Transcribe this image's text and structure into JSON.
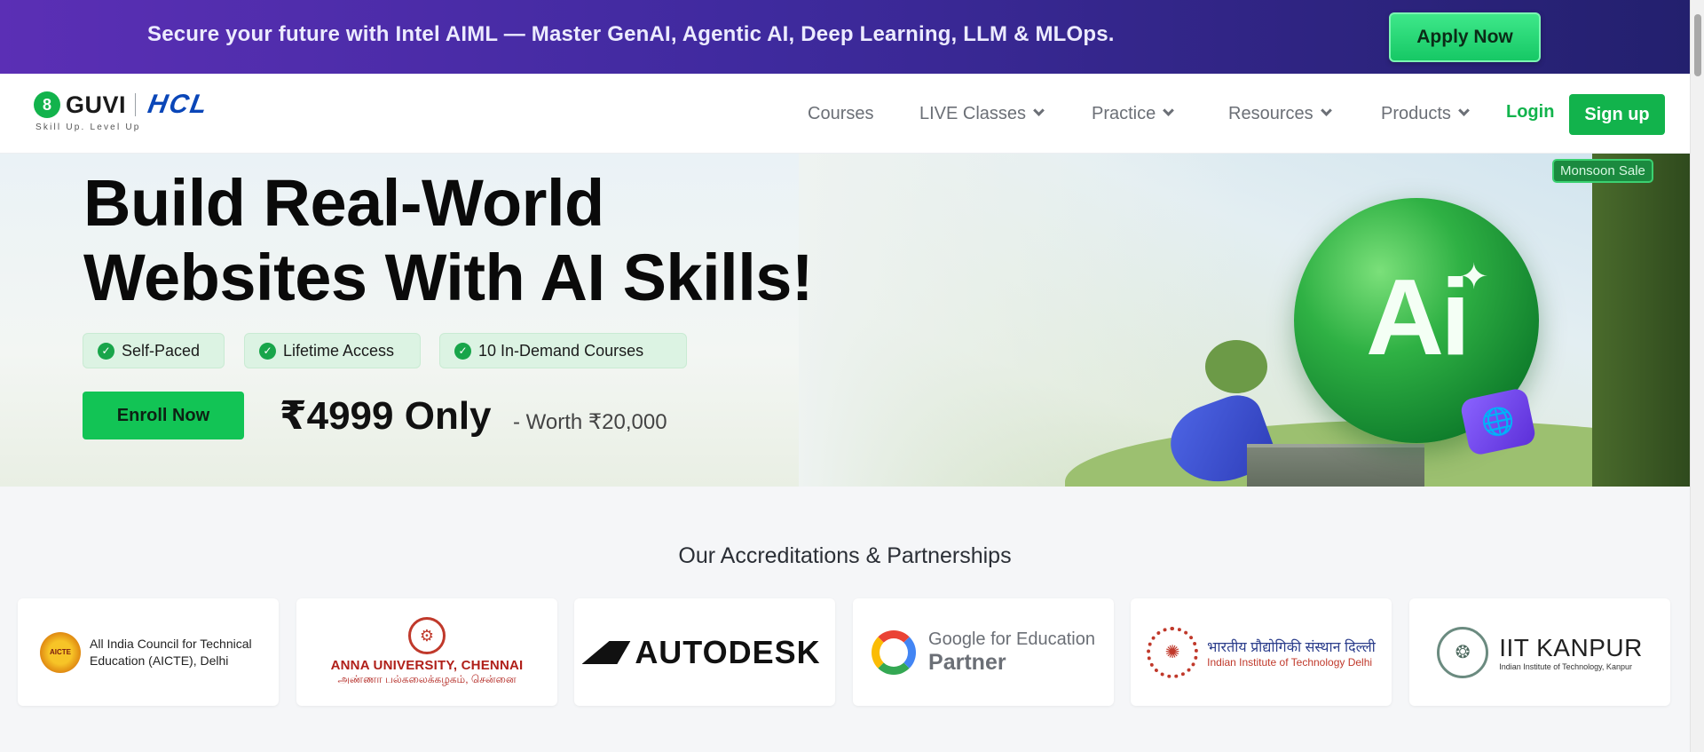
{
  "promo": {
    "text": "Secure your future with Intel AIML — Master GenAI, Agentic AI, Deep Learning, LLM & MLOps.",
    "apply_label": "Apply Now"
  },
  "navbar": {
    "logo_mark": "8",
    "logo_name": "GUVI",
    "partner_logo": "HCL",
    "tagline": "Skill Up. Level Up",
    "items": [
      {
        "label": "Courses",
        "has_dropdown": false
      },
      {
        "label": "LIVE Classes",
        "has_dropdown": true
      },
      {
        "label": "Practice",
        "has_dropdown": true
      },
      {
        "label": "Resources",
        "has_dropdown": true
      },
      {
        "label": "Products",
        "has_dropdown": true
      }
    ],
    "login_label": "Login",
    "signup_label": "Sign up"
  },
  "hero": {
    "sale_tag": "Monsoon Sale",
    "headline_line1": "Build Real-World",
    "headline_line2": "Websites With AI Skills!",
    "chips": [
      "Self-Paced",
      "Lifetime Access",
      "10 In-Demand Courses"
    ],
    "enroll_label": "Enroll Now",
    "price": "₹4999 Only",
    "worth": "- Worth ₹20,000",
    "orb_text": "Ai"
  },
  "accreditations": {
    "title": "Our Accreditations & Partnerships",
    "aicte": {
      "badge": "AICTE",
      "text": "All India Council for Technical Education (AICTE), Delhi"
    },
    "anna": {
      "name": "ANNA UNIVERSITY, CHENNAI",
      "sub": "அண்ணா பல்கலைக்கழகம், சென்னை"
    },
    "autodesk": {
      "name": "AUTODESK"
    },
    "google": {
      "line1": "Google for Education",
      "line2": "Partner"
    },
    "iitd": {
      "hindi": "भारतीय प्रौद्योगिकी संस्थान दिल्ली",
      "english": "Indian Institute of Technology Delhi"
    },
    "iitk": {
      "name": "IIT KANPUR",
      "sub": "Indian Institute of Technology, Kanpur"
    }
  },
  "colors": {
    "brand_green": "#12b34c",
    "promo_purple": "#4a2ca8",
    "accent_green": "#12c455"
  }
}
